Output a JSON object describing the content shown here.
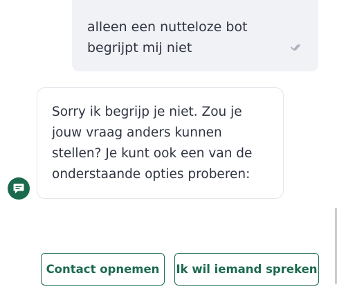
{
  "messages": {
    "user": {
      "text": "alleen een nutteloze bot begrijpt mij niet",
      "status_icon": "double-check-icon"
    },
    "bot": {
      "text": "Sorry ik begrijp je niet. Zou je jouw vraag anders kunnen stellen? Je kunt ook een van de onderstaande opties proberen:",
      "avatar_icon": "chat-bubble-icon"
    }
  },
  "quick_replies": [
    {
      "label": "Contact opnemen"
    },
    {
      "label": "Ik wil iemand spreken"
    }
  ],
  "colors": {
    "brand_green": "#1b6a4d",
    "user_bubble_bg": "#f1f2f6",
    "text": "#2f3442",
    "receipt": "#a9aebb"
  }
}
